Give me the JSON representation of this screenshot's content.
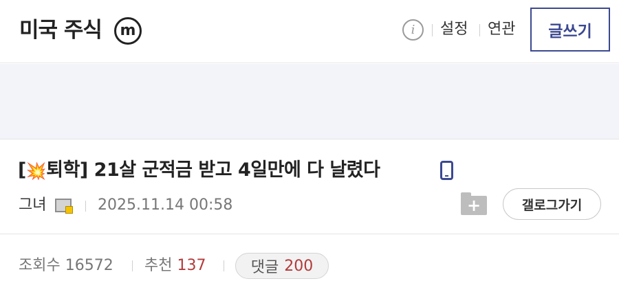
{
  "header": {
    "board_title": "미국 주식",
    "minor_badge": "m",
    "info_icon": "info-icon",
    "settings_label": "설정",
    "related_label": "연관",
    "write_label": "글쓰기"
  },
  "post": {
    "title_prefix": "[",
    "title_icon": "💥",
    "title_tag": "퇴학]",
    "title_text": " 21살 군적금 받고 4일만에 다 날렸다",
    "device_icon": "mobile-icon",
    "author": "그녀",
    "date": "2025.11.14 00:58",
    "gallery_button": "갤로그가기"
  },
  "stats": {
    "views_label": "조회수",
    "views": "16572",
    "recommend_label": "추천",
    "recommend": "137",
    "comments_label": "댓글",
    "comments": "200"
  },
  "colors": {
    "accent": "#3b4890",
    "count_red": "#b33a3a",
    "banner_bg": "#f3f4f9"
  }
}
